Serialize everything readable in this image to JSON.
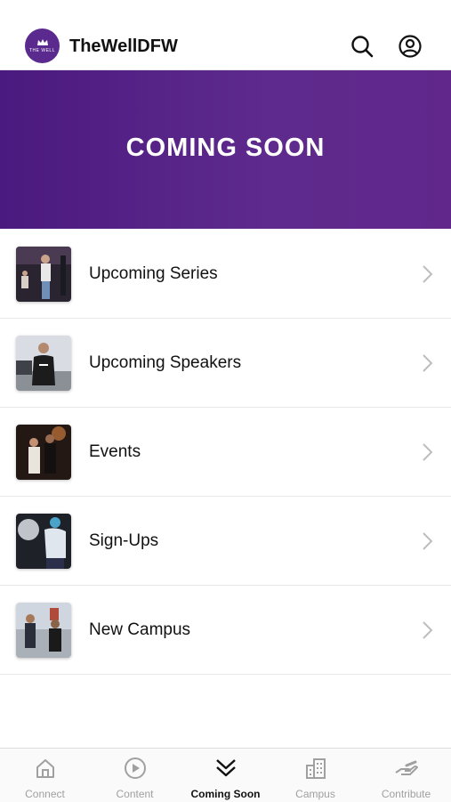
{
  "header": {
    "app_title": "TheWellDFW",
    "logo_text": "THE WELL",
    "icons": [
      "search-icon",
      "account-icon"
    ]
  },
  "banner": {
    "title": "COMING SOON"
  },
  "list": {
    "items": [
      {
        "label": "Upcoming Series"
      },
      {
        "label": "Upcoming Speakers"
      },
      {
        "label": "Events"
      },
      {
        "label": "Sign-Ups"
      },
      {
        "label": "New Campus"
      }
    ]
  },
  "tabbar": {
    "tabs": [
      {
        "label": "Connect",
        "icon": "home-icon"
      },
      {
        "label": "Content",
        "icon": "play-circle-icon"
      },
      {
        "label": "Coming Soon",
        "icon": "double-chevron-down-icon",
        "active": true
      },
      {
        "label": "Campus",
        "icon": "building-icon"
      },
      {
        "label": "Contribute",
        "icon": "giving-hand-icon"
      }
    ]
  },
  "colors": {
    "brand_purple": "#5b2a8e",
    "banner_start": "#4b1a7f",
    "banner_end": "#61278b",
    "inactive_tab": "#a0a0a0"
  }
}
